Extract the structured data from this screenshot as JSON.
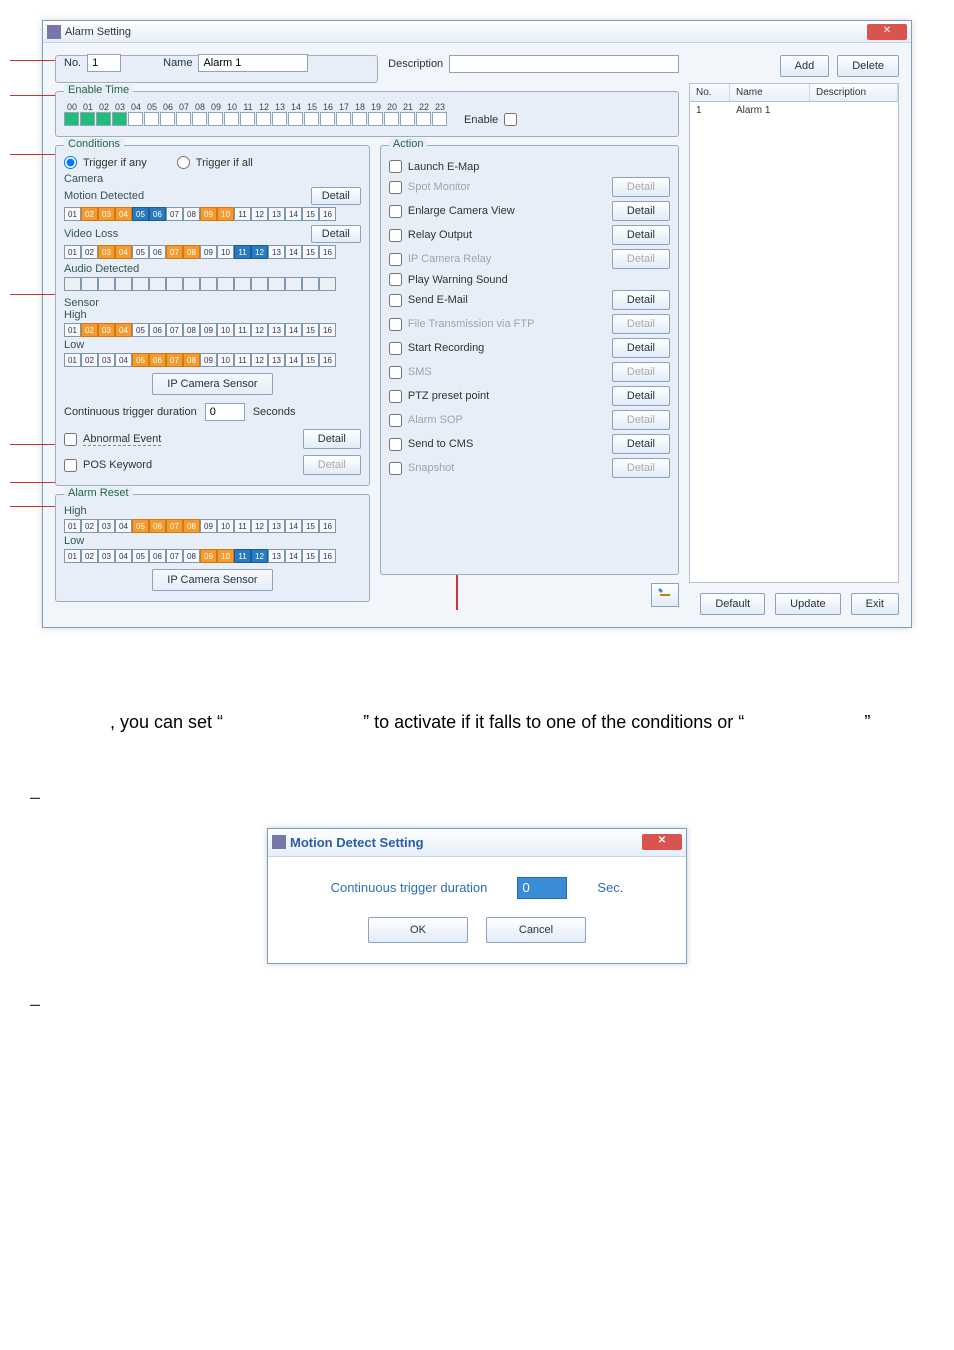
{
  "dlg1": {
    "title": "Alarm Setting",
    "no_lbl": "No.",
    "no_val": "1",
    "name_lbl": "Name",
    "name_val": "Alarm 1",
    "desc_lbl": "Description",
    "add_btn": "Add",
    "del_btn": "Delete",
    "enable_time_legend": "Enable Time",
    "hours": [
      "00",
      "01",
      "02",
      "03",
      "04",
      "05",
      "06",
      "07",
      "08",
      "09",
      "10",
      "11",
      "12",
      "13",
      "14",
      "15",
      "16",
      "17",
      "18",
      "19",
      "20",
      "21",
      "22",
      "23"
    ],
    "enable_chk": "Enable",
    "list": {
      "h_no": "No.",
      "h_name": "Name",
      "h_desc": "Description",
      "r_no": "1",
      "r_name": "Alarm 1"
    },
    "cond": {
      "legend": "Conditions",
      "trig_any": "Trigger if any",
      "trig_all": "Trigger if all",
      "camera_lbl": "Camera",
      "motion_lbl": "Motion Detected",
      "detail": "Detail",
      "video_loss_lbl": "Video Loss",
      "audio_lbl": "Audio Detected",
      "sensor_lbl": "Sensor",
      "high_lbl": "High",
      "low_lbl": "Low",
      "ipcs_btn": "IP Camera Sensor",
      "cont_trig": "Continuous trigger duration",
      "cont_val": "0",
      "cont_unit": "Seconds",
      "abnormal_chk": "Abnormal Event",
      "pos_chk": "POS Keyword"
    },
    "action": {
      "legend": "Action",
      "items": [
        {
          "label": "Launch E-Map",
          "btn": null
        },
        {
          "label": "Spot Monitor",
          "btn": "Detail",
          "dis": true
        },
        {
          "label": "Enlarge Camera View",
          "btn": "Detail"
        },
        {
          "label": "Relay Output",
          "btn": "Detail"
        },
        {
          "label": "IP Camera Relay",
          "btn": "Detail",
          "dis": true
        },
        {
          "label": "Play Warning Sound",
          "btn": null
        },
        {
          "label": "Send E-Mail",
          "btn": "Detail"
        },
        {
          "label": "File Transmission via FTP",
          "btn": "Detail",
          "dis": true
        },
        {
          "label": "Start Recording",
          "btn": "Detail"
        },
        {
          "label": "SMS",
          "btn": "Detail",
          "dis": true
        },
        {
          "label": "PTZ preset point",
          "btn": "Detail"
        },
        {
          "label": "Alarm SOP",
          "btn": "Detail",
          "dis": true
        },
        {
          "label": "Send to CMS",
          "btn": "Detail"
        },
        {
          "label": "Snapshot",
          "btn": "Detail",
          "dis": true
        }
      ]
    },
    "reset": {
      "legend": "Alarm Reset",
      "high": "High",
      "low": "Low",
      "ipcs": "IP Camera Sensor"
    },
    "footer": {
      "default": "Default",
      "update": "Update",
      "exit": "Exit"
    }
  },
  "sentence": {
    "t1": ", you can set “",
    "t2": "” to activate if it falls to one of the conditions or “",
    "t3": "”"
  },
  "bullet_dash": "–",
  "dlg2": {
    "title": "Motion Detect Setting",
    "label": "Continuous trigger duration",
    "val": "0",
    "sec": "Sec.",
    "ok": "OK",
    "cancel": "Cancel"
  },
  "channels": [
    "01",
    "02",
    "03",
    "04",
    "05",
    "06",
    "07",
    "08",
    "09",
    "10",
    "11",
    "12",
    "13",
    "14",
    "15",
    "16"
  ]
}
